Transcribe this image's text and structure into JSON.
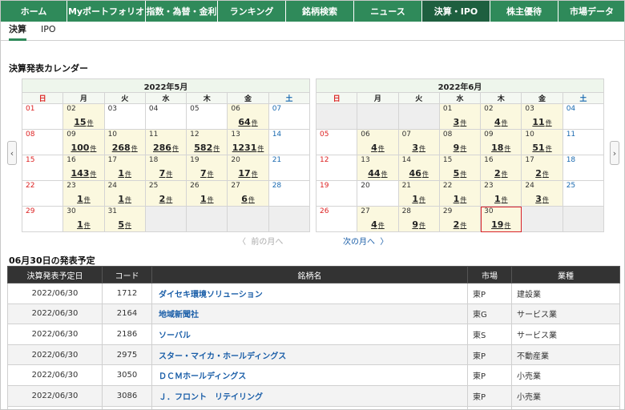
{
  "nav": [
    "ホーム",
    "Myポートフォリオ",
    "指数・為替・金利",
    "ランキング",
    "銘柄検索",
    "ニュース",
    "決算・IPO",
    "株主優待",
    "市場データ"
  ],
  "subtabs": [
    "決算",
    "IPO"
  ],
  "calendar_title": "決算発表カレンダー",
  "weekdays": [
    "日",
    "月",
    "火",
    "水",
    "木",
    "金",
    "土"
  ],
  "count_unit": "件",
  "may": {
    "title": "2022年5月",
    "weeks": [
      [
        [
          "01",
          ""
        ],
        [
          "02",
          "15"
        ],
        [
          "03",
          ""
        ],
        [
          "04",
          ""
        ],
        [
          "05",
          ""
        ],
        [
          "06",
          "64"
        ],
        [
          "07",
          ""
        ]
      ],
      [
        [
          "08",
          ""
        ],
        [
          "09",
          "100"
        ],
        [
          "10",
          "268"
        ],
        [
          "11",
          "286"
        ],
        [
          "12",
          "582"
        ],
        [
          "13",
          "1231"
        ],
        [
          "14",
          ""
        ]
      ],
      [
        [
          "15",
          ""
        ],
        [
          "16",
          "143"
        ],
        [
          "17",
          "1"
        ],
        [
          "18",
          "7"
        ],
        [
          "19",
          "7"
        ],
        [
          "20",
          "17"
        ],
        [
          "21",
          ""
        ]
      ],
      [
        [
          "22",
          ""
        ],
        [
          "23",
          "1"
        ],
        [
          "24",
          "1"
        ],
        [
          "25",
          "2"
        ],
        [
          "26",
          "1"
        ],
        [
          "27",
          "6"
        ],
        [
          "28",
          ""
        ]
      ],
      [
        [
          "29",
          ""
        ],
        [
          "30",
          "1"
        ],
        [
          "31",
          "5"
        ],
        [
          "",
          ""
        ],
        [
          "",
          ""
        ],
        [
          "",
          ""
        ],
        [
          "",
          ""
        ]
      ]
    ]
  },
  "june": {
    "title": "2022年6月",
    "weeks": [
      [
        [
          "",
          ""
        ],
        [
          "",
          ""
        ],
        [
          "",
          ""
        ],
        [
          "01",
          "3"
        ],
        [
          "02",
          "4"
        ],
        [
          "03",
          "11"
        ],
        [
          "04",
          ""
        ]
      ],
      [
        [
          "05",
          ""
        ],
        [
          "06",
          "4"
        ],
        [
          "07",
          "3"
        ],
        [
          "08",
          "9"
        ],
        [
          "09",
          "18"
        ],
        [
          "10",
          "51"
        ],
        [
          "11",
          ""
        ]
      ],
      [
        [
          "12",
          ""
        ],
        [
          "13",
          "44"
        ],
        [
          "14",
          "46"
        ],
        [
          "15",
          "5"
        ],
        [
          "16",
          "2"
        ],
        [
          "17",
          "2"
        ],
        [
          "18",
          ""
        ]
      ],
      [
        [
          "19",
          ""
        ],
        [
          "20",
          ""
        ],
        [
          "21",
          "1"
        ],
        [
          "22",
          "1"
        ],
        [
          "23",
          "1"
        ],
        [
          "24",
          "3"
        ],
        [
          "25",
          ""
        ]
      ],
      [
        [
          "26",
          ""
        ],
        [
          "27",
          "4"
        ],
        [
          "28",
          "9"
        ],
        [
          "29",
          "2"
        ],
        [
          "30",
          "19"
        ],
        [
          "",
          ""
        ],
        [
          "",
          ""
        ]
      ]
    ]
  },
  "prev_month": "前の月へ",
  "next_month": "次の月へ",
  "list_title": "06月30日の発表予定",
  "table_headers": [
    "決算発表予定日",
    "コード",
    "銘柄名",
    "市場",
    "業種"
  ],
  "rows": [
    [
      "2022/06/30",
      "1712",
      "ダイセキ環境ソリューション",
      "東P",
      "建設業"
    ],
    [
      "2022/06/30",
      "2164",
      "地域新聞社",
      "東G",
      "サービス業"
    ],
    [
      "2022/06/30",
      "2186",
      "ソーバル",
      "東S",
      "サービス業"
    ],
    [
      "2022/06/30",
      "2975",
      "スター・マイカ・ホールディングス",
      "東P",
      "不動産業"
    ],
    [
      "2022/06/30",
      "3050",
      "ＤＣＭホールディングス",
      "東P",
      "小売業"
    ],
    [
      "2022/06/30",
      "3086",
      "Ｊ．フロント　リテイリング",
      "東P",
      "小売業"
    ],
    [
      "",
      "",
      "",
      "",
      ""
    ]
  ]
}
